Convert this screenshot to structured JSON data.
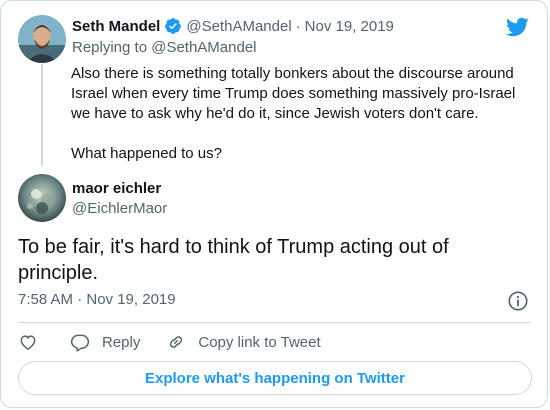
{
  "quoted_tweet": {
    "author_name": "Seth Mandel",
    "author_handle": "@SethAMandel",
    "separator": "·",
    "date": "Nov 19, 2019",
    "replying_to": "Replying to @SethAMandel",
    "paragraph_1": "Also there is something totally bonkers about the discourse around Israel when every time Trump does something massively pro-Israel we have to ask why he'd do it, since Jewish voters don't care.",
    "paragraph_2": "What happened to us?"
  },
  "tweet": {
    "author_name": "maor eichler",
    "author_handle": "@EichlerMaor",
    "text": "To be fair, it's hard to think of Trump acting out of principle.",
    "timestamp": "7:58 AM · Nov 19, 2019"
  },
  "actions": {
    "reply_label": "Reply",
    "copy_link_label": "Copy link to Tweet"
  },
  "explore_button": "Explore what's happening on Twitter",
  "colors": {
    "twitter_blue": "#1d9bf0",
    "muted_text": "#536471",
    "border": "#cfd9de"
  },
  "icons": [
    "verified-badge-icon",
    "twitter-bird-icon",
    "info-icon",
    "heart-icon",
    "reply-icon",
    "link-icon"
  ]
}
